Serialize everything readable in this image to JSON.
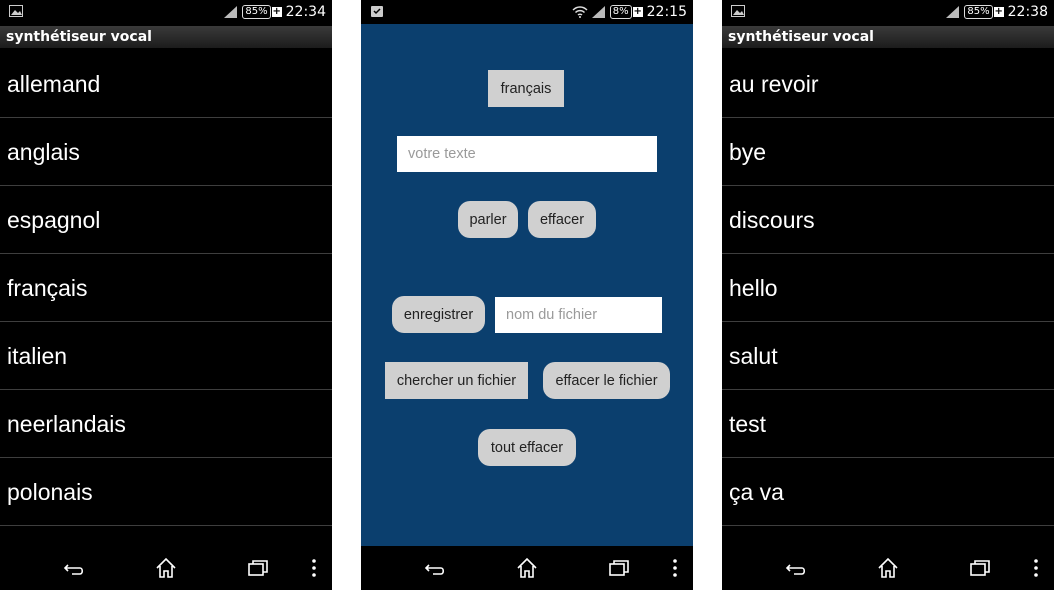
{
  "left_screen": {
    "status": {
      "battery": "85%",
      "time": "22:34"
    },
    "title": "synthétiseur vocal",
    "items": [
      "allemand",
      "anglais",
      "espagnol",
      "français",
      "italien",
      "neerlandais",
      "polonais"
    ]
  },
  "middle_screen": {
    "status": {
      "battery": "8%",
      "time": "22:15"
    },
    "language_button": "français",
    "text_placeholder": "votre texte",
    "speak_button": "parler",
    "clear_button": "effacer",
    "record_button": "enregistrer",
    "filename_placeholder": "nom du fichier",
    "search_file_button": "chercher un fichier",
    "delete_file_button": "effacer le fichier",
    "clear_all_button": "tout effacer",
    "colors": {
      "background": "#0b3f6e",
      "button": "#d0d0d0"
    }
  },
  "right_screen": {
    "status": {
      "battery": "85%",
      "time": "22:38"
    },
    "title": "synthétiseur vocal",
    "items": [
      "au revoir",
      "bye",
      "discours",
      "hello",
      "salut",
      "test",
      "ça va"
    ]
  },
  "nav_icons": [
    "back-icon",
    "home-icon",
    "recent-apps-icon",
    "overflow-menu-icon"
  ]
}
